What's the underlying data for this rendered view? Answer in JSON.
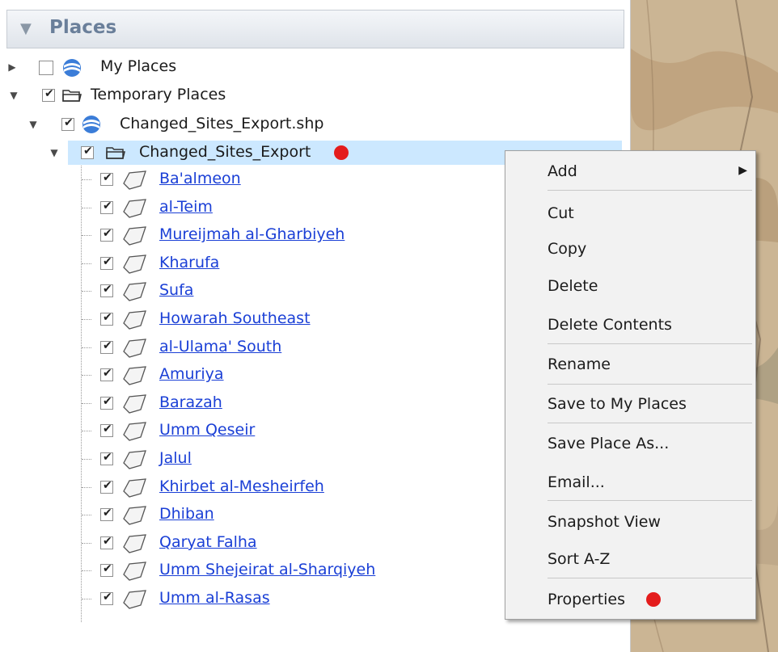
{
  "panel": {
    "title": "Places"
  },
  "tree": {
    "my_places": "My Places",
    "temporary_places": "Temporary Places",
    "shapefile": "Changed_Sites_Export.shp",
    "folder": "Changed_Sites_Export",
    "sites": [
      "Ba'almeon",
      "al-Teim",
      "Mureijmah al-Gharbiyeh",
      "Kharufa",
      "Sufa",
      "Howarah Southeast",
      "al-Ulama' South",
      "Amuriya",
      "Barazah",
      "Umm Qeseir",
      "Jalul",
      "Khirbet al-Mesheirfeh",
      "Dhiban",
      "Qaryat Falha",
      "Umm Shejeirat al-Sharqiyeh",
      "Umm al-Rasas"
    ]
  },
  "context_menu": {
    "add": "Add",
    "cut": "Cut",
    "copy": "Copy",
    "delete": "Delete",
    "delete_contents": "Delete Contents",
    "rename": "Rename",
    "save_to_my_places": "Save to My Places",
    "save_place_as": "Save Place As...",
    "email": "Email...",
    "snapshot_view": "Snapshot View",
    "sort": "Sort A-Z",
    "properties": "Properties"
  },
  "icons": {
    "collapse": "triangle-down-icon",
    "expand": "triangle-right-icon",
    "globe": "globe-icon",
    "folder": "folder-icon",
    "polygon": "polygon-icon",
    "marker": "red-dot-icon"
  },
  "colors": {
    "selection": "#cce8ff",
    "link": "#1a3fd6",
    "marker": "#e41c1c",
    "header_text": "#6a7f9a"
  }
}
